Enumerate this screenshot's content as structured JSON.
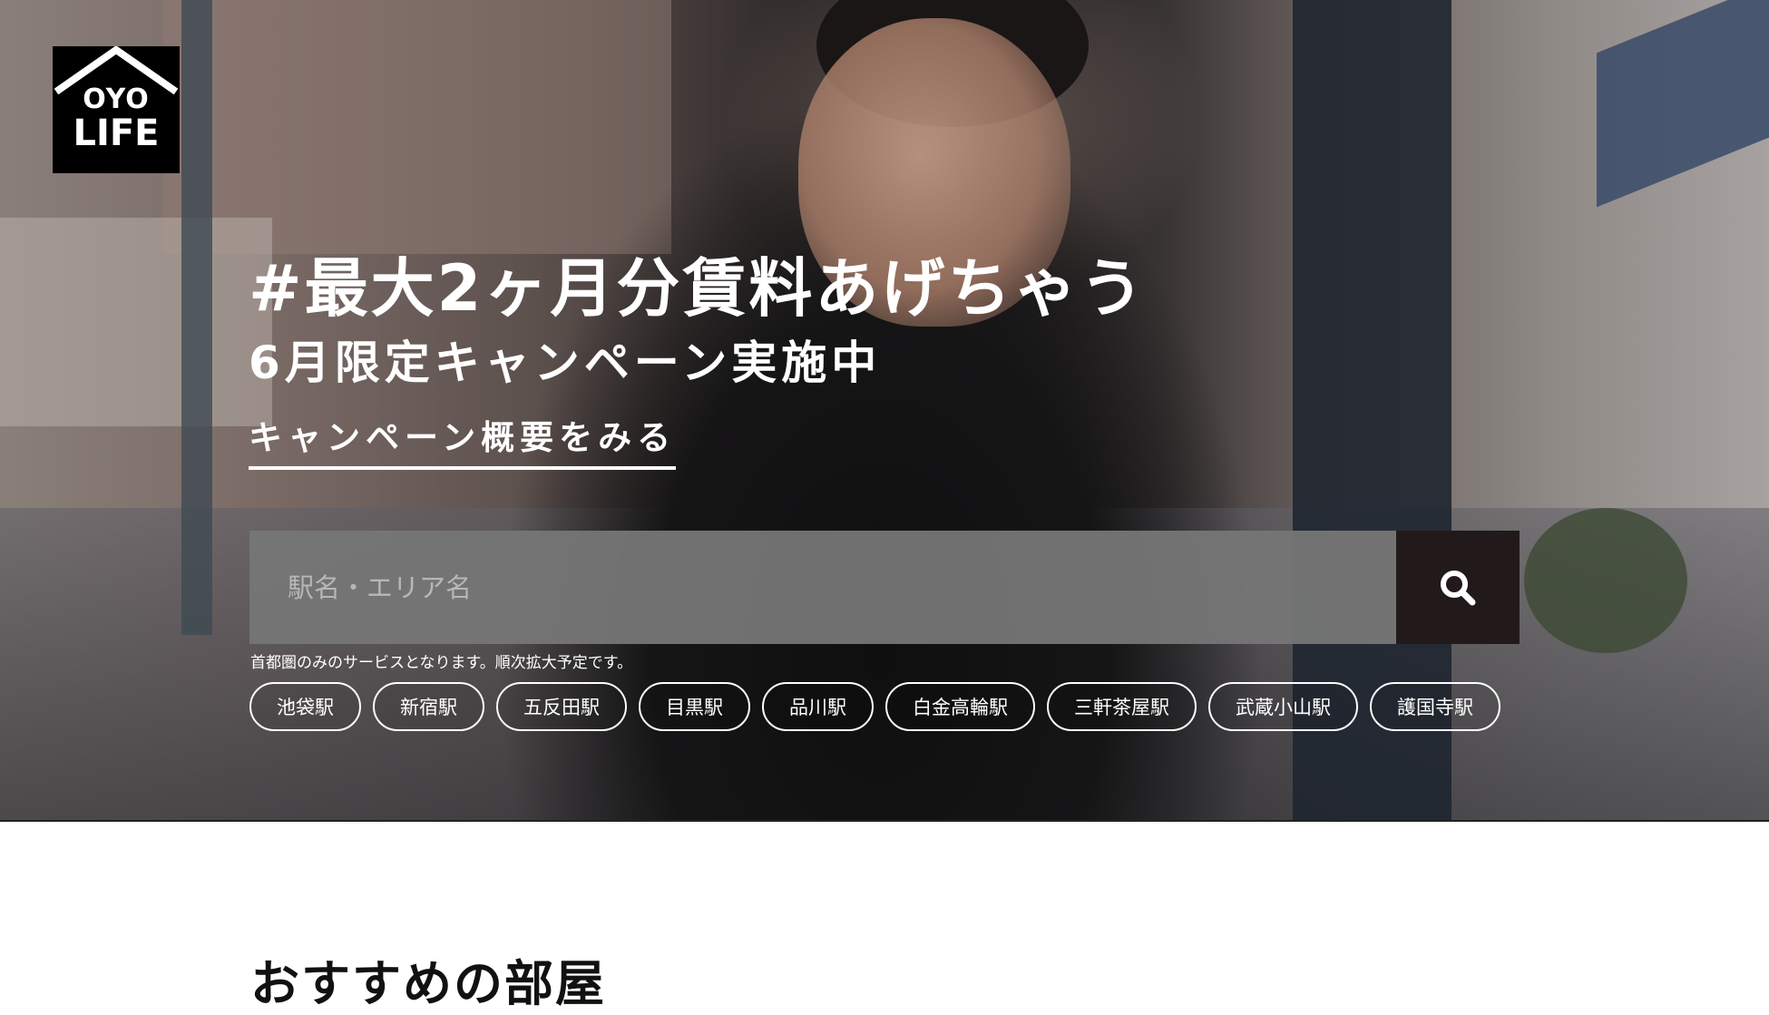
{
  "brand": {
    "logo_top": "OYO",
    "logo_bottom": "LIFE"
  },
  "hero": {
    "headline": "#最大2ヶ月分賃料あげちゃう",
    "subline": "6月限定キャンペーン実施中",
    "campaign_link": "キャンペーン概要をみる"
  },
  "search": {
    "placeholder": "駅名・エリア名",
    "button_icon": "search-icon",
    "note": "首都圏のみのサービスとなります。順次拡大予定です。"
  },
  "stations": [
    "池袋駅",
    "新宿駅",
    "五反田駅",
    "目黒駅",
    "品川駅",
    "白金高輪駅",
    "三軒茶屋駅",
    "武蔵小山駅",
    "護国寺駅"
  ],
  "sections": {
    "recommended_title": "おすすめの部屋"
  },
  "colors": {
    "search_button": "#221a1a",
    "search_field": "#767676",
    "text_on_hero": "#ffffff"
  }
}
